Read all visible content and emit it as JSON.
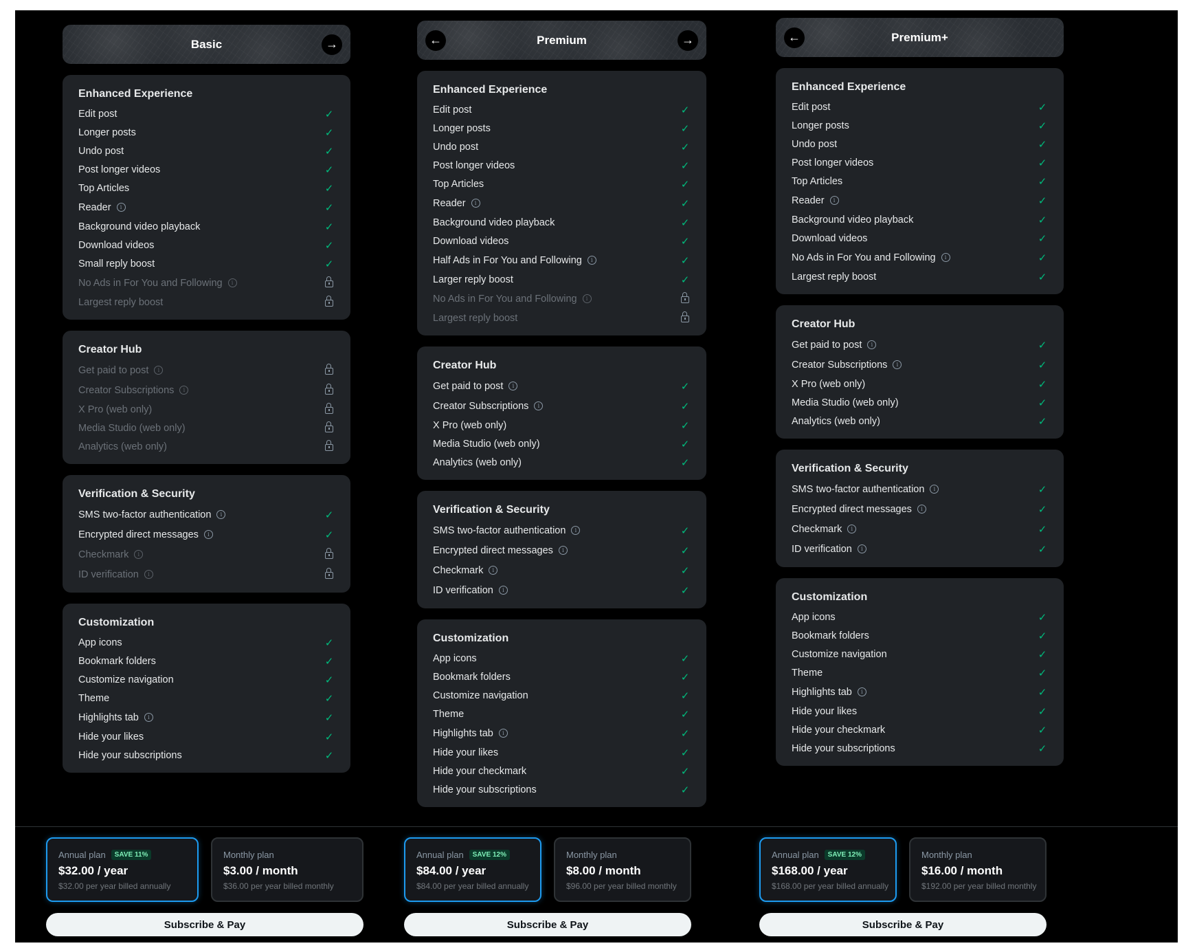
{
  "panels": [
    {
      "plan": "Basic",
      "has_back": false,
      "has_next": true,
      "sections": [
        {
          "title": "Enhanced Experience",
          "items": [
            {
              "label": "Edit post",
              "info": false,
              "locked": false
            },
            {
              "label": "Longer posts",
              "info": false,
              "locked": false
            },
            {
              "label": "Undo post",
              "info": false,
              "locked": false
            },
            {
              "label": "Post longer videos",
              "info": false,
              "locked": false
            },
            {
              "label": "Top Articles",
              "info": false,
              "locked": false
            },
            {
              "label": "Reader",
              "info": true,
              "locked": false
            },
            {
              "label": "Background video playback",
              "info": false,
              "locked": false
            },
            {
              "label": "Download videos",
              "info": false,
              "locked": false
            },
            {
              "label": "Small reply boost",
              "info": false,
              "locked": false
            },
            {
              "label": "No Ads in For You and Following",
              "info": true,
              "locked": true
            },
            {
              "label": "Largest reply boost",
              "info": false,
              "locked": true
            }
          ]
        },
        {
          "title": "Creator Hub",
          "items": [
            {
              "label": "Get paid to post",
              "info": true,
              "locked": true
            },
            {
              "label": "Creator Subscriptions",
              "info": true,
              "locked": true
            },
            {
              "label": "X Pro (web only)",
              "info": false,
              "locked": true
            },
            {
              "label": "Media Studio (web only)",
              "info": false,
              "locked": true
            },
            {
              "label": "Analytics (web only)",
              "info": false,
              "locked": true
            }
          ]
        },
        {
          "title": "Verification & Security",
          "items": [
            {
              "label": "SMS two-factor authentication",
              "info": true,
              "locked": false
            },
            {
              "label": "Encrypted direct messages",
              "info": true,
              "locked": false
            },
            {
              "label": "Checkmark",
              "info": true,
              "locked": true
            },
            {
              "label": "ID verification",
              "info": true,
              "locked": true
            }
          ]
        },
        {
          "title": "Customization",
          "items": [
            {
              "label": "App icons",
              "info": false,
              "locked": false
            },
            {
              "label": "Bookmark folders",
              "info": false,
              "locked": false
            },
            {
              "label": "Customize navigation",
              "info": false,
              "locked": false
            },
            {
              "label": "Theme",
              "info": false,
              "locked": false
            },
            {
              "label": "Highlights tab",
              "info": true,
              "locked": false
            },
            {
              "label": "Hide your likes",
              "info": false,
              "locked": false
            },
            {
              "label": "Hide your subscriptions",
              "info": false,
              "locked": false
            }
          ]
        }
      ],
      "annual": {
        "label": "Annual plan",
        "badge": "SAVE 11%",
        "price": "$32.00 / year",
        "sub": "$32.00 per year billed annually"
      },
      "monthly": {
        "label": "Monthly plan",
        "price": "$3.00 / month",
        "sub": "$36.00 per year billed monthly"
      },
      "subscribe_label": "Subscribe & Pay"
    },
    {
      "plan": "Premium",
      "has_back": true,
      "has_next": true,
      "sections": [
        {
          "title": "Enhanced Experience",
          "items": [
            {
              "label": "Edit post",
              "info": false,
              "locked": false
            },
            {
              "label": "Longer posts",
              "info": false,
              "locked": false
            },
            {
              "label": "Undo post",
              "info": false,
              "locked": false
            },
            {
              "label": "Post longer videos",
              "info": false,
              "locked": false
            },
            {
              "label": "Top Articles",
              "info": false,
              "locked": false
            },
            {
              "label": "Reader",
              "info": true,
              "locked": false
            },
            {
              "label": "Background video playback",
              "info": false,
              "locked": false
            },
            {
              "label": "Download videos",
              "info": false,
              "locked": false
            },
            {
              "label": "Half Ads in For You and Following",
              "info": true,
              "locked": false
            },
            {
              "label": "Larger reply boost",
              "info": false,
              "locked": false
            },
            {
              "label": "No Ads in For You and Following",
              "info": true,
              "locked": true
            },
            {
              "label": "Largest reply boost",
              "info": false,
              "locked": true
            }
          ]
        },
        {
          "title": "Creator Hub",
          "items": [
            {
              "label": "Get paid to post",
              "info": true,
              "locked": false
            },
            {
              "label": "Creator Subscriptions",
              "info": true,
              "locked": false
            },
            {
              "label": "X Pro (web only)",
              "info": false,
              "locked": false
            },
            {
              "label": "Media Studio (web only)",
              "info": false,
              "locked": false
            },
            {
              "label": "Analytics (web only)",
              "info": false,
              "locked": false
            }
          ]
        },
        {
          "title": "Verification & Security",
          "items": [
            {
              "label": "SMS two-factor authentication",
              "info": true,
              "locked": false
            },
            {
              "label": "Encrypted direct messages",
              "info": true,
              "locked": false
            },
            {
              "label": "Checkmark",
              "info": true,
              "locked": false
            },
            {
              "label": "ID verification",
              "info": true,
              "locked": false
            }
          ]
        },
        {
          "title": "Customization",
          "items": [
            {
              "label": "App icons",
              "info": false,
              "locked": false
            },
            {
              "label": "Bookmark folders",
              "info": false,
              "locked": false
            },
            {
              "label": "Customize navigation",
              "info": false,
              "locked": false
            },
            {
              "label": "Theme",
              "info": false,
              "locked": false
            },
            {
              "label": "Highlights tab",
              "info": true,
              "locked": false
            },
            {
              "label": "Hide your likes",
              "info": false,
              "locked": false
            },
            {
              "label": "Hide your checkmark",
              "info": false,
              "locked": false
            },
            {
              "label": "Hide your subscriptions",
              "info": false,
              "locked": false
            }
          ]
        }
      ],
      "annual": {
        "label": "Annual plan",
        "badge": "SAVE 12%",
        "price": "$84.00 / year",
        "sub": "$84.00 per year billed annually"
      },
      "monthly": {
        "label": "Monthly plan",
        "price": "$8.00 / month",
        "sub": "$96.00 per year billed monthly"
      },
      "subscribe_label": "Subscribe & Pay"
    },
    {
      "plan": "Premium+",
      "has_back": true,
      "has_next": false,
      "sections": [
        {
          "title": "Enhanced Experience",
          "items": [
            {
              "label": "Edit post",
              "info": false,
              "locked": false
            },
            {
              "label": "Longer posts",
              "info": false,
              "locked": false
            },
            {
              "label": "Undo post",
              "info": false,
              "locked": false
            },
            {
              "label": "Post longer videos",
              "info": false,
              "locked": false
            },
            {
              "label": "Top Articles",
              "info": false,
              "locked": false
            },
            {
              "label": "Reader",
              "info": true,
              "locked": false
            },
            {
              "label": "Background video playback",
              "info": false,
              "locked": false
            },
            {
              "label": "Download videos",
              "info": false,
              "locked": false
            },
            {
              "label": "No Ads in For You and Following",
              "info": true,
              "locked": false
            },
            {
              "label": "Largest reply boost",
              "info": false,
              "locked": false
            }
          ]
        },
        {
          "title": "Creator Hub",
          "items": [
            {
              "label": "Get paid to post",
              "info": true,
              "locked": false
            },
            {
              "label": "Creator Subscriptions",
              "info": true,
              "locked": false
            },
            {
              "label": "X Pro (web only)",
              "info": false,
              "locked": false
            },
            {
              "label": "Media Studio (web only)",
              "info": false,
              "locked": false
            },
            {
              "label": "Analytics (web only)",
              "info": false,
              "locked": false
            }
          ]
        },
        {
          "title": "Verification & Security",
          "items": [
            {
              "label": "SMS two-factor authentication",
              "info": true,
              "locked": false
            },
            {
              "label": "Encrypted direct messages",
              "info": true,
              "locked": false
            },
            {
              "label": "Checkmark",
              "info": true,
              "locked": false
            },
            {
              "label": "ID verification",
              "info": true,
              "locked": false
            }
          ]
        },
        {
          "title": "Customization",
          "items": [
            {
              "label": "App icons",
              "info": false,
              "locked": false
            },
            {
              "label": "Bookmark folders",
              "info": false,
              "locked": false
            },
            {
              "label": "Customize navigation",
              "info": false,
              "locked": false
            },
            {
              "label": "Theme",
              "info": false,
              "locked": false
            },
            {
              "label": "Highlights tab",
              "info": true,
              "locked": false
            },
            {
              "label": "Hide your likes",
              "info": false,
              "locked": false
            },
            {
              "label": "Hide your checkmark",
              "info": false,
              "locked": false
            },
            {
              "label": "Hide your subscriptions",
              "info": false,
              "locked": false
            }
          ]
        }
      ],
      "annual": {
        "label": "Annual plan",
        "badge": "SAVE 12%",
        "price": "$168.00 / year",
        "sub": "$168.00 per year billed annually"
      },
      "monthly": {
        "label": "Monthly plan",
        "price": "$16.00 / month",
        "sub": "$192.00 per year billed monthly"
      },
      "subscribe_label": "Subscribe & Pay"
    }
  ]
}
